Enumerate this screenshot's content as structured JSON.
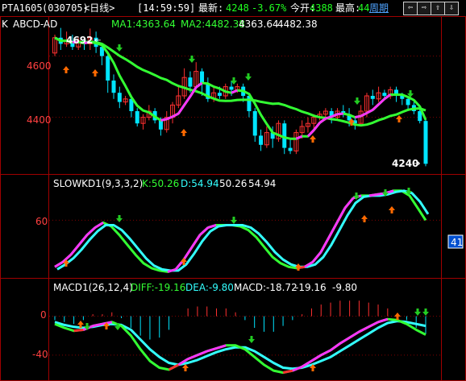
{
  "header": {
    "symbol": "PTA1605",
    "code": "(030705)",
    "period": "<日线>",
    "time": "[14:59:59]",
    "latest_label": "最新:",
    "latest_value": "4248",
    "change_pct": "-3.67%",
    "open_label": "今开:",
    "open_value": "4388",
    "high_label": "最高:",
    "high_value": "44",
    "period_link": "周期",
    "nav_buttons": [
      "⇦",
      "⇨",
      "⇧",
      "⇩",
      "◁"
    ]
  },
  "kline_panel": {
    "legend_prefix": "K",
    "legend_name": "ABCD-AD",
    "ma1": "MA1:4363.64",
    "ma2": "MA2:4482.38",
    "val1": "4363.64",
    "val2": "4482.38",
    "max_label": "4692",
    "min_label": "4240",
    "y_ticks": [
      "4600",
      "4400"
    ]
  },
  "kd_panel": {
    "title": "SLOWKD1(9,3,3,2)",
    "k": "K:50.26",
    "d": "D:54.94",
    "val1": "50.26",
    "val2": "54.94",
    "y_tick": "60",
    "badge": "41"
  },
  "macd_panel": {
    "title": "MACD1(26,12,4)",
    "diff": "DIFF:-19.16",
    "dea": "DEA:-9.80",
    "macd": "MACD:-18.72",
    "val1": "-19.16",
    "val2": "-9.80",
    "y_ticks": [
      "0",
      "-40"
    ]
  },
  "colors": {
    "up": "#ff3030",
    "down": "#00e5ff",
    "ma_green": "#33ff33",
    "ma_magenta": "#ff33ff",
    "grid": "#800000",
    "axis": "#a00000",
    "label_red": "#ff4040",
    "header_green": "#20ff20"
  },
  "chart_data": [
    {
      "type": "candlestick",
      "title": "",
      "ylim": [
        4220,
        4720
      ],
      "ma_labels": [
        "MA1",
        "MA2"
      ],
      "candles": [
        [
          4610,
          4660,
          4600,
          4670
        ],
        [
          4660,
          4640,
          4620,
          4692
        ],
        [
          4640,
          4650,
          4630,
          4680
        ],
        [
          4650,
          4630,
          4620,
          4670
        ],
        [
          4630,
          4650,
          4620,
          4660
        ],
        [
          4650,
          4640,
          4620,
          4660
        ],
        [
          4640,
          4660,
          4620,
          4690
        ],
        [
          4660,
          4630,
          4610,
          4680
        ],
        [
          4630,
          4600,
          4570,
          4640
        ],
        [
          4600,
          4520,
          4480,
          4610
        ],
        [
          4520,
          4480,
          4460,
          4540
        ],
        [
          4480,
          4450,
          4430,
          4500
        ],
        [
          4450,
          4460,
          4440,
          4470
        ],
        [
          4460,
          4420,
          4400,
          4470
        ],
        [
          4420,
          4380,
          4370,
          4430
        ],
        [
          4380,
          4400,
          4360,
          4410
        ],
        [
          4400,
          4420,
          4390,
          4440
        ],
        [
          4420,
          4390,
          4380,
          4430
        ],
        [
          4390,
          4360,
          4340,
          4400
        ],
        [
          4360,
          4400,
          4350,
          4420
        ],
        [
          4400,
          4440,
          4380,
          4450
        ],
        [
          4440,
          4470,
          4430,
          4500
        ],
        [
          4470,
          4530,
          4460,
          4560
        ],
        [
          4530,
          4500,
          4480,
          4550
        ],
        [
          4500,
          4550,
          4490,
          4580
        ],
        [
          4550,
          4510,
          4470,
          4560
        ],
        [
          4510,
          4460,
          4450,
          4530
        ],
        [
          4460,
          4480,
          4450,
          4500
        ],
        [
          4480,
          4470,
          4460,
          4500
        ],
        [
          4470,
          4500,
          4460,
          4510
        ],
        [
          4500,
          4490,
          4470,
          4520
        ],
        [
          4490,
          4500,
          4480,
          4510
        ],
        [
          4500,
          4470,
          4450,
          4510
        ],
        [
          4470,
          4420,
          4400,
          4480
        ],
        [
          4420,
          4340,
          4320,
          4430
        ],
        [
          4340,
          4310,
          4290,
          4360
        ],
        [
          4310,
          4350,
          4300,
          4370
        ],
        [
          4350,
          4330,
          4300,
          4370
        ],
        [
          4330,
          4380,
          4320,
          4390
        ],
        [
          4380,
          4300,
          4280,
          4390
        ],
        [
          4300,
          4290,
          4280,
          4330
        ],
        [
          4290,
          4350,
          4280,
          4360
        ],
        [
          4350,
          4370,
          4330,
          4390
        ],
        [
          4370,
          4380,
          4350,
          4400
        ],
        [
          4380,
          4400,
          4360,
          4410
        ],
        [
          4400,
          4410,
          4390,
          4420
        ],
        [
          4410,
          4420,
          4390,
          4430
        ],
        [
          4420,
          4400,
          4380,
          4430
        ],
        [
          4400,
          4420,
          4390,
          4430
        ],
        [
          4420,
          4410,
          4400,
          4440
        ],
        [
          4410,
          4390,
          4370,
          4430
        ],
        [
          4390,
          4380,
          4360,
          4400
        ],
        [
          4380,
          4420,
          4370,
          4440
        ],
        [
          4420,
          4470,
          4400,
          4480
        ],
        [
          4470,
          4460,
          4440,
          4490
        ],
        [
          4460,
          4480,
          4450,
          4500
        ],
        [
          4480,
          4470,
          4460,
          4490
        ],
        [
          4470,
          4490,
          4460,
          4500
        ],
        [
          4490,
          4470,
          4450,
          4500
        ],
        [
          4470,
          4460,
          4440,
          4480
        ],
        [
          4460,
          4440,
          4420,
          4470
        ],
        [
          4440,
          4420,
          4410,
          4450
        ],
        [
          4420,
          4388,
          4380,
          4430
        ],
        [
          4388,
          4248,
          4240,
          4400
        ]
      ]
    },
    {
      "type": "line",
      "title": "SLOWKD1(9,3,3,2)",
      "series_names": [
        "K",
        "D"
      ],
      "ylim": [
        15,
        95
      ],
      "k": [
        22,
        26,
        32,
        40,
        48,
        54,
        58,
        55,
        48,
        40,
        32,
        25,
        21,
        19,
        18,
        20,
        28,
        38,
        48,
        54,
        56,
        56,
        56,
        55,
        52,
        46,
        38,
        30,
        25,
        22,
        21,
        22,
        26,
        34,
        46,
        58,
        70,
        78,
        80,
        80,
        81,
        82,
        84,
        84,
        80,
        70,
        60
      ],
      "d": [
        20,
        24,
        29,
        36,
        44,
        51,
        56,
        56,
        52,
        45,
        37,
        29,
        23,
        20,
        19,
        19,
        24,
        33,
        43,
        51,
        55,
        56,
        56,
        56,
        54,
        49,
        42,
        34,
        28,
        24,
        22,
        22,
        24,
        30,
        40,
        52,
        64,
        74,
        79,
        80,
        80,
        81,
        83,
        84,
        82,
        75,
        65
      ]
    },
    {
      "type": "line",
      "title": "MACD1(26,12,4)",
      "series_names": [
        "DIFF",
        "DEA",
        "MACD"
      ],
      "ylim": [
        -65,
        22
      ],
      "diff": [
        -8,
        -12,
        -15,
        -14,
        -10,
        -8,
        -6,
        -10,
        -20,
        -34,
        -46,
        -53,
        -55,
        -50,
        -44,
        -40,
        -36,
        -33,
        -30,
        -30,
        -34,
        -42,
        -50,
        -56,
        -58,
        -56,
        -52,
        -46,
        -40,
        -35,
        -28,
        -22,
        -16,
        -11,
        -6,
        -3,
        -4,
        -8,
        -14,
        -19
      ],
      "dea": [
        -6,
        -9,
        -11,
        -12,
        -11,
        -9,
        -8,
        -9,
        -14,
        -24,
        -34,
        -42,
        -48,
        -50,
        -48,
        -45,
        -41,
        -37,
        -34,
        -32,
        -32,
        -36,
        -42,
        -48,
        -53,
        -54,
        -53,
        -50,
        -46,
        -42,
        -36,
        -30,
        -24,
        -18,
        -12,
        -7,
        -5,
        -6,
        -8,
        -10
      ],
      "macd": [
        -4,
        -6,
        -8,
        -4,
        2,
        2,
        4,
        -2,
        -12,
        -20,
        -24,
        -22,
        -14,
        0,
        8,
        10,
        10,
        8,
        8,
        4,
        -4,
        -12,
        -16,
        -16,
        -10,
        -4,
        2,
        8,
        12,
        14,
        16,
        16,
        16,
        14,
        12,
        8,
        2,
        -4,
        -12,
        -18
      ]
    }
  ]
}
